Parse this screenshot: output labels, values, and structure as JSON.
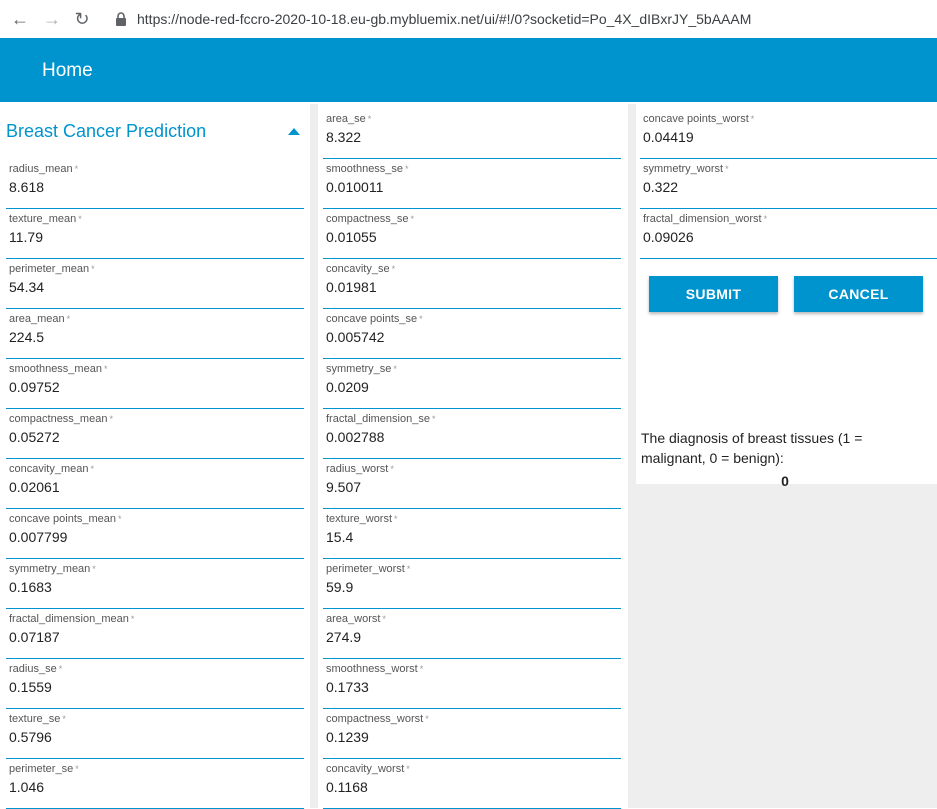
{
  "browser": {
    "url": "https://node-red-fccro-2020-10-18.eu-gb.mybluemix.net/ui/#!/0?socketid=Po_4X_dIBxrJY_5bAAAM"
  },
  "toolbar": {
    "title": "Home"
  },
  "form": {
    "title": "Breast Cancer Prediction",
    "required_mark": "*",
    "column1": [
      {
        "label": "radius_mean",
        "value": "8.618"
      },
      {
        "label": "texture_mean",
        "value": "11.79"
      },
      {
        "label": "perimeter_mean",
        "value": "54.34"
      },
      {
        "label": "area_mean",
        "value": "224.5"
      },
      {
        "label": "smoothness_mean",
        "value": "0.09752"
      },
      {
        "label": "compactness_mean",
        "value": "0.05272"
      },
      {
        "label": "concavity_mean",
        "value": "0.02061"
      },
      {
        "label": "concave points_mean",
        "value": "0.007799"
      },
      {
        "label": "symmetry_mean",
        "value": "0.1683"
      },
      {
        "label": "fractal_dimension_mean",
        "value": "0.07187"
      },
      {
        "label": "radius_se",
        "value": "0.1559"
      },
      {
        "label": "texture_se",
        "value": "0.5796"
      },
      {
        "label": "perimeter_se",
        "value": "1.046"
      }
    ],
    "column2": [
      {
        "label": "area_se",
        "value": "8.322"
      },
      {
        "label": "smoothness_se",
        "value": "0.010011"
      },
      {
        "label": "compactness_se",
        "value": "0.01055"
      },
      {
        "label": "concavity_se",
        "value": "0.01981"
      },
      {
        "label": "concave points_se",
        "value": "0.005742"
      },
      {
        "label": "symmetry_se",
        "value": "0.0209"
      },
      {
        "label": "fractal_dimension_se",
        "value": "0.002788"
      },
      {
        "label": "radius_worst",
        "value": "9.507"
      },
      {
        "label": "texture_worst",
        "value": "15.4"
      },
      {
        "label": "perimeter_worst",
        "value": "59.9"
      },
      {
        "label": "area_worst",
        "value": "274.9"
      },
      {
        "label": "smoothness_worst",
        "value": "0.1733"
      },
      {
        "label": "compactness_worst",
        "value": "0.1239"
      },
      {
        "label": "concavity_worst",
        "value": "0.1168"
      }
    ],
    "column3": [
      {
        "label": "concave points_worst",
        "value": "0.04419"
      },
      {
        "label": "symmetry_worst",
        "value": "0.322"
      },
      {
        "label": "fractal_dimension_worst",
        "value": "0.09026"
      }
    ],
    "submit_label": "SUBMIT",
    "cancel_label": "CANCEL"
  },
  "result": {
    "text": "The diagnosis of breast tissues (1 = malignant, 0 = benign):",
    "value": "0"
  }
}
